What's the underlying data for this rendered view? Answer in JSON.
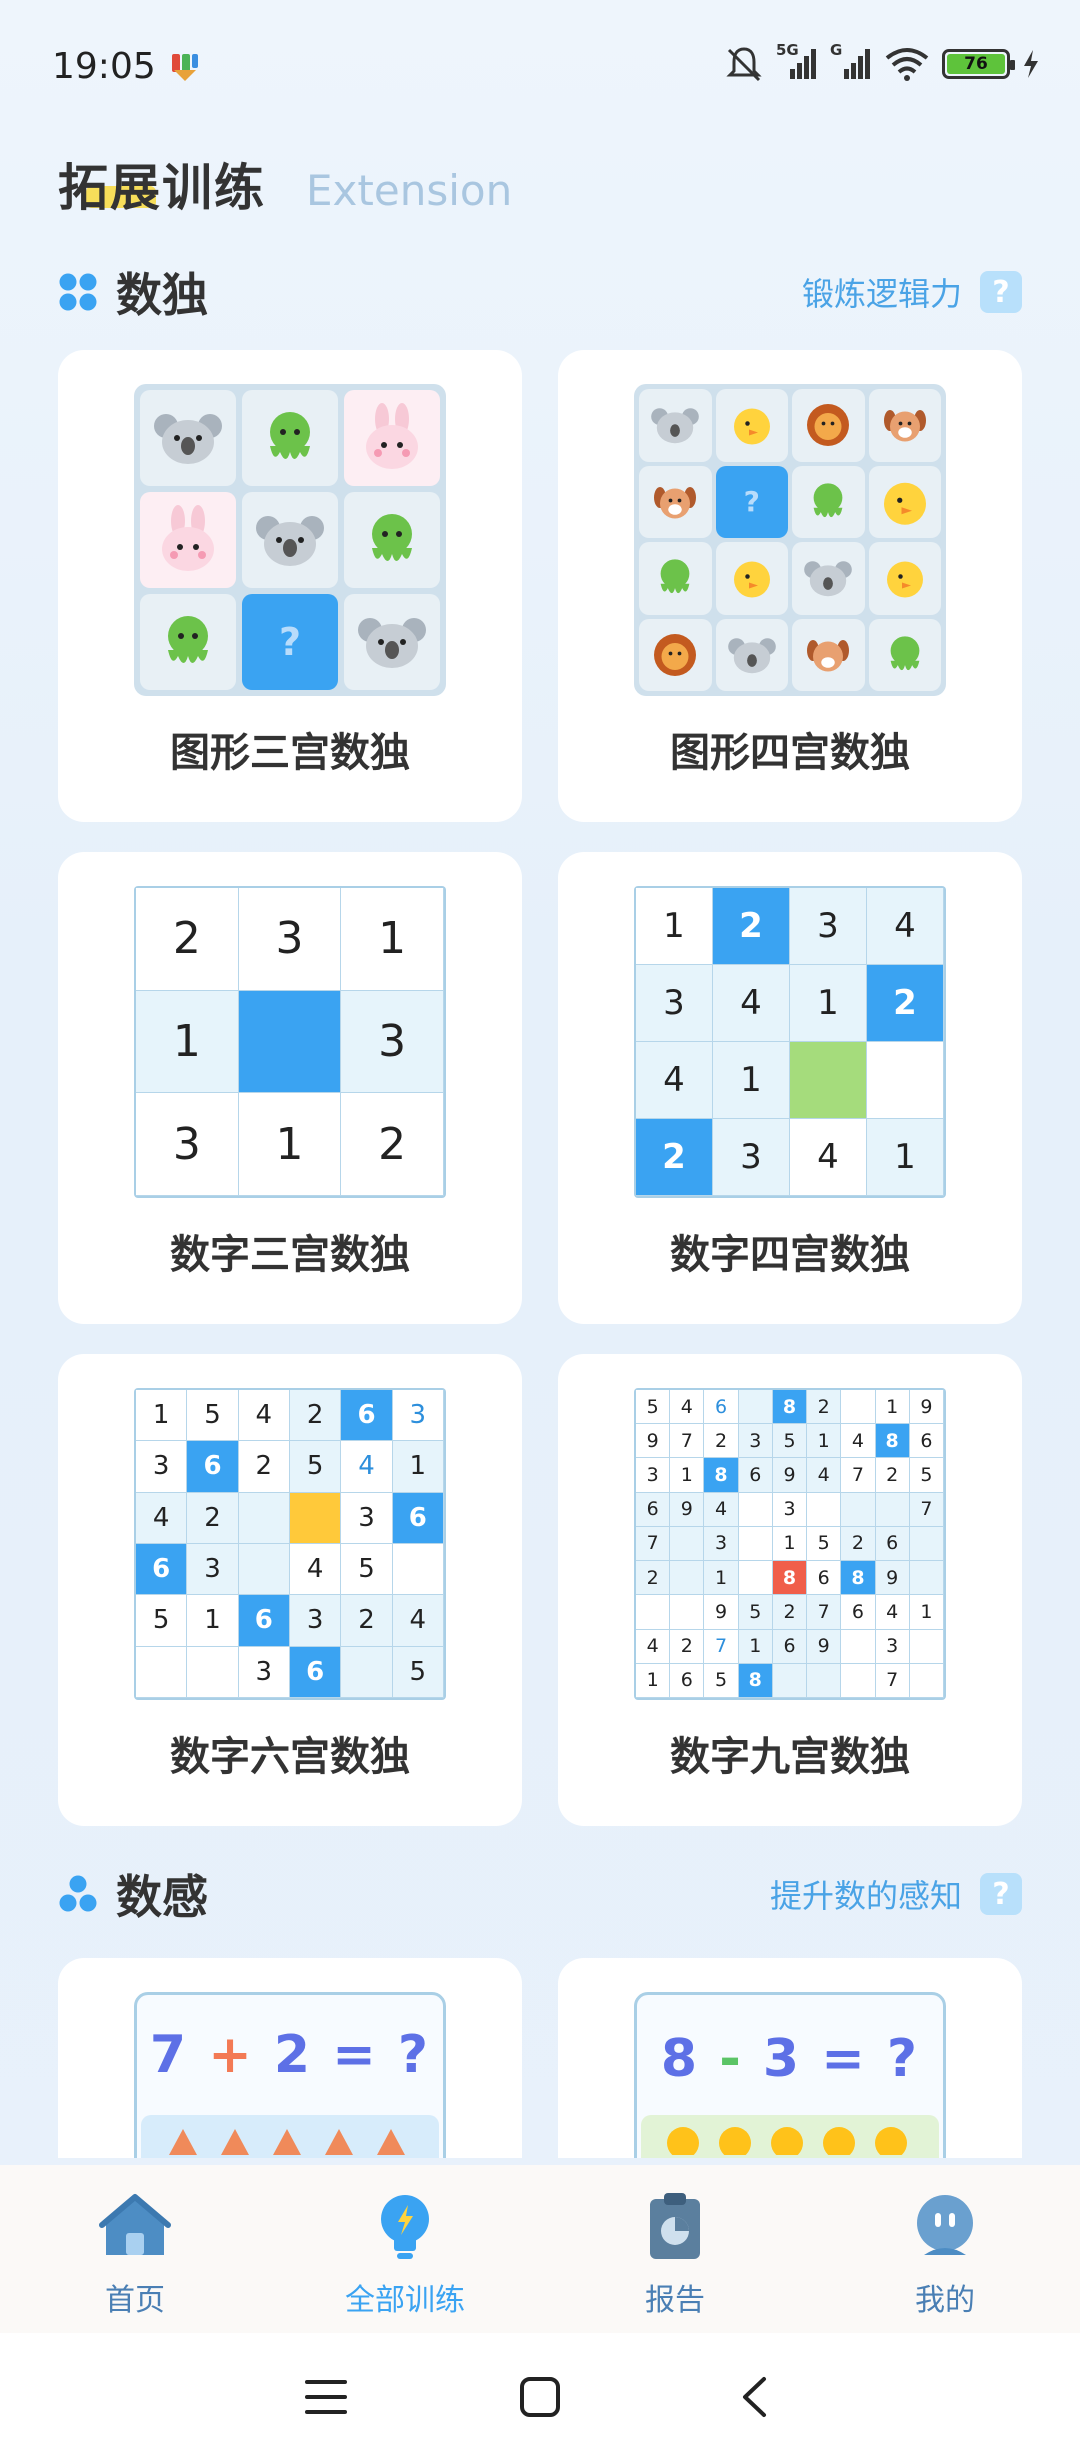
{
  "status_bar": {
    "time": "19:05",
    "battery_level": "76",
    "signal_1_label": "5G",
    "signal_2_label": "G"
  },
  "header": {
    "title": "拓展训练",
    "subtitle": "Extension"
  },
  "sudoku_section": {
    "title": "数独",
    "hint": "锻炼逻辑力",
    "help": "?",
    "cards": [
      {
        "label": "图形三宫数独"
      },
      {
        "label": "图形四宫数独"
      },
      {
        "label": "数字三宫数独"
      },
      {
        "label": "数字四宫数独"
      },
      {
        "label": "数字六宫数独"
      },
      {
        "label": "数字九宫数独"
      }
    ],
    "pic3_q": "?",
    "pic4_q": "?"
  },
  "number_sense_section": {
    "title": "数感",
    "hint": "提升数的感知",
    "help": "?",
    "cards": [
      {
        "eq_a": "7",
        "eq_op": "+",
        "eq_b": "2",
        "eq_eq": "=",
        "eq_q": "?"
      },
      {
        "eq_a": "8",
        "eq_op": "-",
        "eq_b": "3",
        "eq_eq": "=",
        "eq_q": "?"
      }
    ]
  },
  "bottom_nav": {
    "items": [
      {
        "label": "首页",
        "icon": "home-icon"
      },
      {
        "label": "全部训练",
        "icon": "lightbulb-icon"
      },
      {
        "label": "报告",
        "icon": "clipboard-report-icon"
      },
      {
        "label": "我的",
        "icon": "robot-avatar-icon"
      }
    ]
  },
  "colors": {
    "accent": "#3aa3f2",
    "card": "#ffffff",
    "background": "#eaf2fb"
  }
}
